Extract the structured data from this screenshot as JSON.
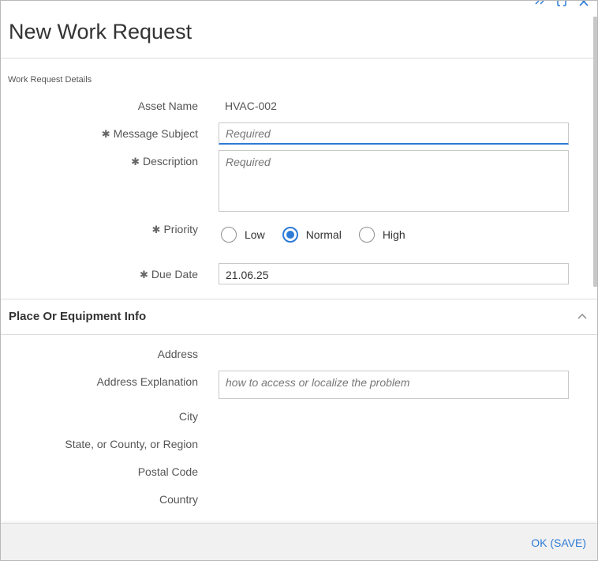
{
  "dialog": {
    "title": "New Work Request",
    "controls": [
      "expand-icon",
      "maximize-icon",
      "close-icon"
    ]
  },
  "details": {
    "section_label": "Work Request Details",
    "asset_name": {
      "label": "Asset Name",
      "value": "HVAC-002"
    },
    "message_subject": {
      "label": "Message Subject",
      "placeholder": "Required",
      "required_mark": "✱"
    },
    "description": {
      "label": "Description",
      "placeholder": "Required",
      "required_mark": "✱"
    },
    "priority": {
      "label": "Priority",
      "required_mark": "✱",
      "options": [
        "Low",
        "Normal",
        "High"
      ],
      "selected": "Normal"
    },
    "due_date": {
      "label": "Due Date",
      "value": "21.06.25",
      "required_mark": "✱"
    }
  },
  "place_section": {
    "title": "Place Or Equipment Info",
    "expanded": true,
    "address_label": "Address",
    "address_explanation": {
      "label": "Address Explanation",
      "placeholder": "how to access or localize the problem"
    },
    "city_label": "City",
    "region_label": "State, or County, or Region",
    "postal_label": "Postal Code",
    "country_label": "Country"
  },
  "footer": {
    "ok_label": "OK (SAVE)"
  },
  "colors": {
    "accent": "#2e7bd6",
    "border": "#c9c9c9",
    "footer_bg": "#f1f1f1"
  }
}
